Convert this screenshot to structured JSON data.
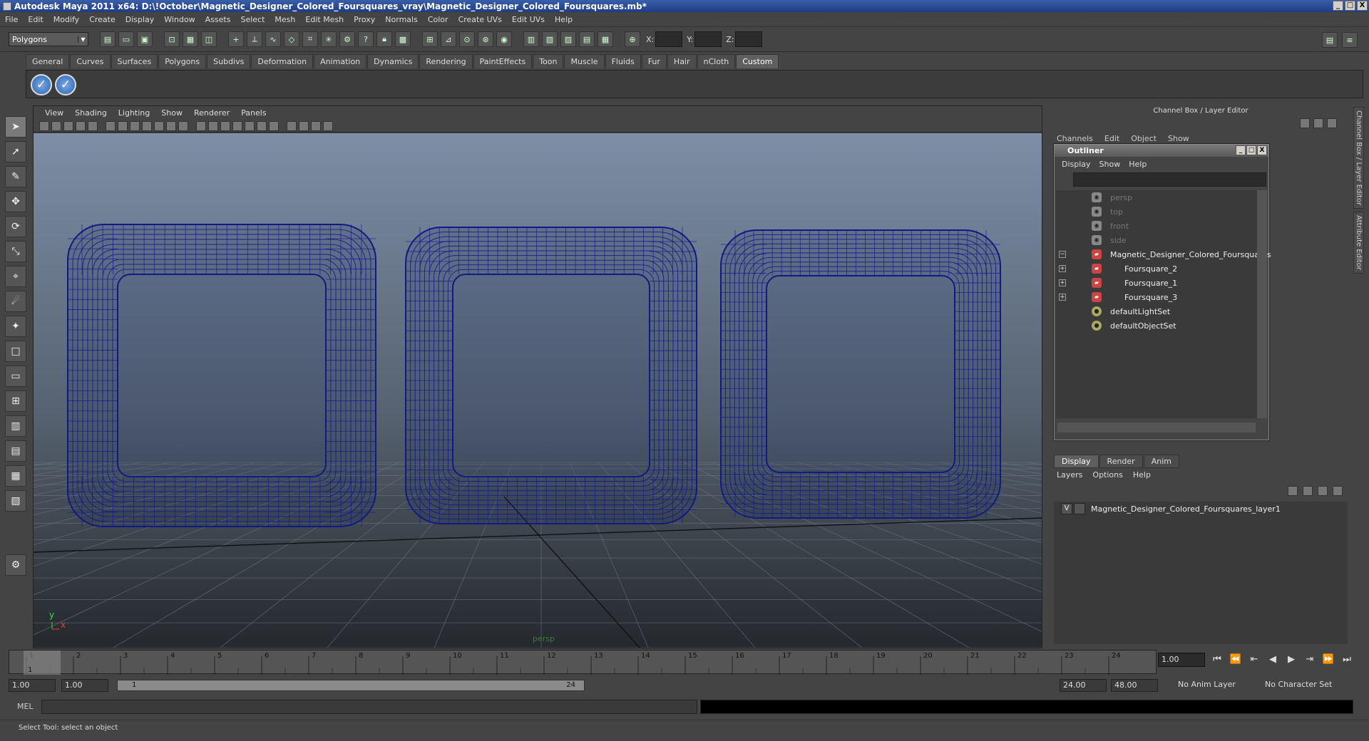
{
  "window": {
    "title": "Autodesk Maya 2011 x64: D:\\!October\\Magnetic_Designer_Colored_Foursquares_vray\\Magnetic_Designer_Colored_Foursquares.mb*",
    "min": "_",
    "max": "□",
    "close": "X"
  },
  "menubar": [
    "File",
    "Edit",
    "Modify",
    "Create",
    "Display",
    "Window",
    "Assets",
    "Select",
    "Mesh",
    "Edit Mesh",
    "Proxy",
    "Normals",
    "Color",
    "Create UVs",
    "Edit UVs",
    "Help"
  ],
  "status": {
    "mode": "Polygons",
    "x_label": "X:",
    "y_label": "Y:",
    "z_label": "Z:"
  },
  "shelf": {
    "tabs": [
      "General",
      "Curves",
      "Surfaces",
      "Polygons",
      "Subdivs",
      "Deformation",
      "Animation",
      "Dynamics",
      "Rendering",
      "PaintEffects",
      "Toon",
      "Muscle",
      "Fluids",
      "Fur",
      "Hair",
      "nCloth",
      "Custom"
    ],
    "active": "Custom"
  },
  "viewport": {
    "menu": [
      "View",
      "Shading",
      "Lighting",
      "Show",
      "Renderer",
      "Panels"
    ],
    "camera": "persp",
    "axis_y": "y",
    "axis_x": "x",
    "wire_color": "#101a86"
  },
  "channelbox": {
    "title": "Channel Box / Layer Editor",
    "menu": [
      "Channels",
      "Edit",
      "Object",
      "Show"
    ]
  },
  "outliner": {
    "title": "Outliner",
    "menu": [
      "Display",
      "Show",
      "Help"
    ],
    "items": [
      {
        "label": "persp",
        "type": "camera",
        "dim": true,
        "exp": ""
      },
      {
        "label": "top",
        "type": "camera",
        "dim": true,
        "exp": ""
      },
      {
        "label": "front",
        "type": "camera",
        "dim": true,
        "exp": ""
      },
      {
        "label": "side",
        "type": "camera",
        "dim": true,
        "exp": ""
      },
      {
        "label": "Magnetic_Designer_Colored_Foursquares",
        "type": "mesh",
        "dim": false,
        "exp": "−"
      },
      {
        "label": "Foursquare_2",
        "type": "mesh",
        "dim": false,
        "exp": "+"
      },
      {
        "label": "Foursquare_1",
        "type": "mesh",
        "dim": false,
        "exp": "+"
      },
      {
        "label": "Foursquare_3",
        "type": "mesh",
        "dim": false,
        "exp": "+"
      },
      {
        "label": "defaultLightSet",
        "type": "set",
        "dim": false,
        "exp": ""
      },
      {
        "label": "defaultObjectSet",
        "type": "set",
        "dim": false,
        "exp": ""
      }
    ]
  },
  "layers": {
    "tabs": [
      "Display",
      "Render",
      "Anim"
    ],
    "active": "Display",
    "menu": [
      "Layers",
      "Options",
      "Help"
    ],
    "layer_visible": "V",
    "layer_name": "Magnetic_Designer_Colored_Foursquares_layer1"
  },
  "sidetabs": [
    "Channel Box / Layer Editor",
    "Attribute Editor"
  ],
  "timeline": {
    "ticks": [
      "1",
      "2",
      "3",
      "4",
      "5",
      "6",
      "7",
      "8",
      "9",
      "10",
      "11",
      "12",
      "13",
      "14",
      "15",
      "16",
      "17",
      "18",
      "19",
      "20",
      "21",
      "22",
      "23",
      "24"
    ],
    "current": "1.00",
    "frame_marker": "1"
  },
  "range": {
    "start": "1.00",
    "start2": "1.00",
    "inner_start": "1",
    "inner_end": "24",
    "end": "24.00",
    "end2": "48.00",
    "anim_layer": "No Anim Layer",
    "char_set": "No Character Set"
  },
  "cmd": {
    "label": "MEL"
  },
  "help": {
    "text": "Select Tool: select an object"
  }
}
